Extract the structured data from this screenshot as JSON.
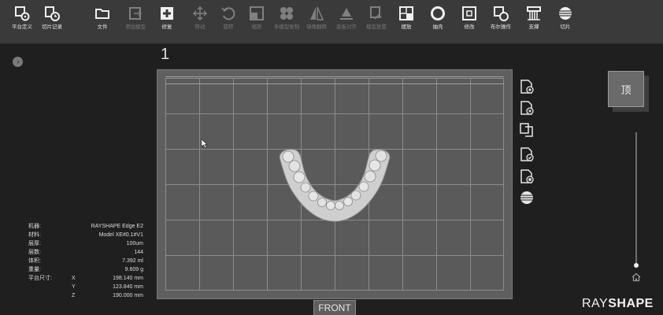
{
  "toolbar": {
    "items": [
      {
        "label": "平台定义",
        "icon": "platform-gear-icon",
        "enabled": true
      },
      {
        "label": "切片记录",
        "icon": "history-clock-icon",
        "enabled": true
      },
      {
        "label": "文件",
        "icon": "folder-icon",
        "enabled": true
      },
      {
        "label": "添加模型",
        "icon": "add-model-icon",
        "enabled": false
      },
      {
        "label": "修复",
        "icon": "repair-plus-icon",
        "enabled": true
      },
      {
        "label": "移动",
        "icon": "move-arrows-icon",
        "enabled": false
      },
      {
        "label": "旋转",
        "icon": "rotate-icon",
        "enabled": false
      },
      {
        "label": "缩放",
        "icon": "scale-icon",
        "enabled": false
      },
      {
        "label": "多模型复制",
        "icon": "clone-icon",
        "enabled": false
      },
      {
        "label": "镜像翻转",
        "icon": "mirror-icon",
        "enabled": false
      },
      {
        "label": "底板对齐",
        "icon": "lay-flat-icon",
        "enabled": false
      },
      {
        "label": "模型放置",
        "icon": "place-model-icon",
        "enabled": false
      },
      {
        "label": "摆放",
        "icon": "arrange-icon",
        "enabled": true
      },
      {
        "label": "抽壳",
        "icon": "hollow-icon",
        "enabled": true
      },
      {
        "label": "修改",
        "icon": "modify-icon",
        "enabled": true
      },
      {
        "label": "布尔操作",
        "icon": "boolean-icon",
        "enabled": true
      },
      {
        "label": "支撑",
        "icon": "support-icon",
        "enabled": true
      },
      {
        "label": "切片",
        "icon": "slice-icon",
        "enabled": true
      }
    ]
  },
  "viewport": {
    "plate_number": "1",
    "front_label": "FRONT",
    "view_cube_label": "顶"
  },
  "info": {
    "machine": {
      "label": "机器:",
      "value": "RAYSHAPE Edge E2"
    },
    "material": {
      "label": "材料:",
      "value": "Model XE#0.1#V1"
    },
    "layer_thickness": {
      "label": "层厚:",
      "value": "100um"
    },
    "layer_count": {
      "label": "层数:",
      "value": "144"
    },
    "volume": {
      "label": "体积:",
      "value": "7.392 ml"
    },
    "weight": {
      "label": "重量:",
      "value": "9.609 g"
    },
    "platform_size": {
      "label": "平台尺寸:",
      "x": {
        "axis": "X",
        "value": "198.140 mm"
      },
      "y": {
        "axis": "Y",
        "value": "123.840 mm"
      },
      "z": {
        "axis": "Z",
        "value": "190.000 mm"
      }
    }
  },
  "brand": {
    "light": "RAY",
    "bold": "SHAPE"
  },
  "colors": {
    "toolbar_bg": "#3a3a3a",
    "viewport_bg": "#1f1f1f",
    "plate": "#5f5f5f",
    "model": "#d0d0d0"
  }
}
